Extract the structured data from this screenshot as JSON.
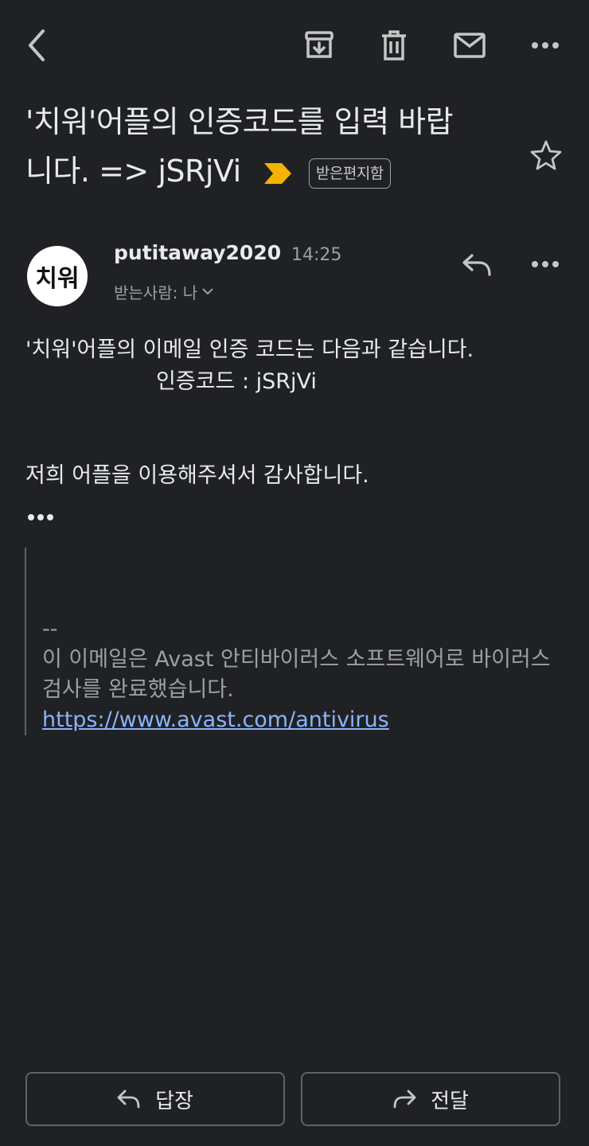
{
  "toolbar": {
    "back": "back-icon",
    "archive": "archive-icon",
    "delete": "trash-icon",
    "mark_unread": "mail-icon",
    "more": "more-icon"
  },
  "subject": {
    "line1": "'치워'어플의 인증코드를 입력 바랍",
    "line2": "니다. => jSRjVi",
    "label": "받은편지함"
  },
  "message": {
    "avatar_text": "치워",
    "sender": "putitaway2020",
    "time": "14:25",
    "recipient": "받는사람: 나",
    "line1": "'치워'어플의 이메일 인증 코드는 다음과 같습니다.",
    "line2": "인증코드 : jSRjVi",
    "line3": "저희 어플을 이용해주셔서 감사합니다.",
    "quote_dash": "--",
    "quote_text": "이 이메일은 Avast 안티바이러스 소프트웨어로 바이러스 검사를 완료했습니다.",
    "quote_link": "https://www.avast.com/antivirus"
  },
  "actions": {
    "reply": "답장",
    "forward": "전달"
  },
  "colors": {
    "background": "#202124",
    "importance": "#f2b400",
    "link": "#8ab4f8"
  }
}
